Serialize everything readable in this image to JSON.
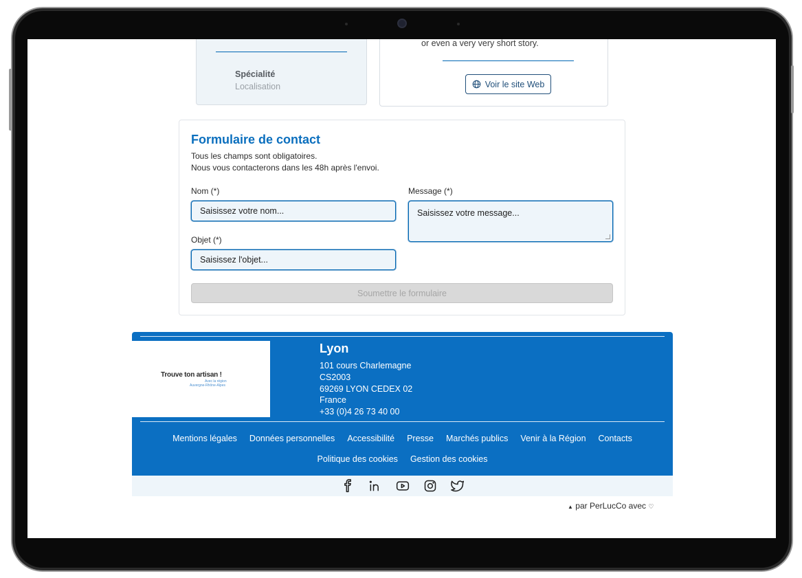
{
  "cards": {
    "left": {
      "specialite": "Spécialité",
      "localisation": "Localisation"
    },
    "right": {
      "story_text": "or even a very very short story.",
      "website_button": "Voir le site Web"
    }
  },
  "form": {
    "title": "Formulaire de contact",
    "intro_line1": "Tous les champs sont obligatoires.",
    "intro_line2": "Nous vous contacterons dans les  48h après l'envoi.",
    "nom_label": "Nom (*)",
    "nom_placeholder": "Saisissez votre nom...",
    "objet_label": "Objet (*)",
    "objet_placeholder": "Saisissez l'objet...",
    "message_label": "Message (*)",
    "message_placeholder": "Saisissez votre message...",
    "submit_label": "Soumettre le formulaire"
  },
  "footer": {
    "logo": {
      "main": "Trouve ton artisan !",
      "sub1": "Avec la région",
      "sub2": "Auvergne-Rhône-Alpes"
    },
    "city": "Lyon",
    "address": [
      "101 cours Charlemagne",
      "CS2003",
      "69269 LYON CEDEX 02",
      "France",
      "+33 (0)4 26 73 40 00"
    ],
    "links_row1": [
      "Mentions légales",
      "Données personnelles",
      "Accessibilité",
      "Presse",
      "Marchés publics",
      "Venir à la Région",
      "Contacts"
    ],
    "links_row2": [
      "Politique des cookies",
      "Gestion des cookies"
    ],
    "social_icons": [
      "facebook-icon",
      "linkedin-icon",
      "youtube-icon",
      "instagram-icon",
      "twitter-icon"
    ],
    "credit": "par PerLucCo avec"
  },
  "colors": {
    "brand": "#0b6fc2",
    "title": "#0b6fbe",
    "input_bg": "#eef5fa"
  }
}
